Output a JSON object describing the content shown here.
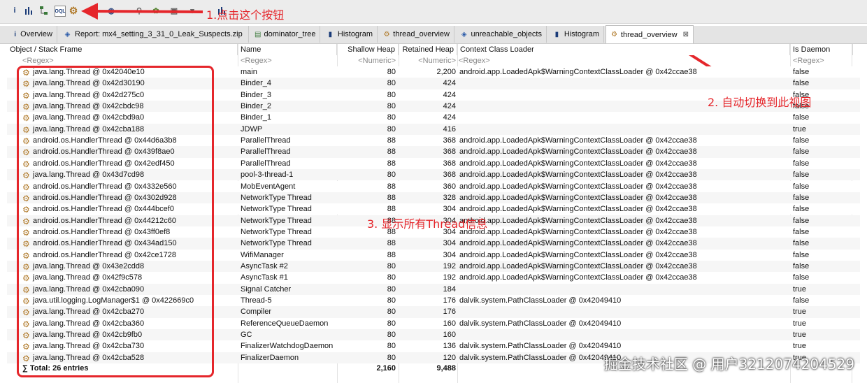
{
  "toolbar": {
    "icons": [
      "info-icon",
      "histogram-icon",
      "dominator-tree-icon",
      "oql-icon",
      "thread-overview-icon"
    ]
  },
  "annotations": {
    "step1": "1.点击这个按钮",
    "step2": "2. 自动切换到此视图",
    "step3": "3. 显示所有Thread信息"
  },
  "tabs": [
    {
      "label": "Overview",
      "icon": "info-icon"
    },
    {
      "label": "Report: mx4_setting_3_31_0_Leak_Suspects.zip",
      "icon": "report-icon"
    },
    {
      "label": "dominator_tree",
      "icon": "dominator-tree-icon"
    },
    {
      "label": "Histogram",
      "icon": "histogram-icon"
    },
    {
      "label": "thread_overview",
      "icon": "thread-icon"
    },
    {
      "label": "unreachable_objects",
      "icon": "unreachable-icon"
    },
    {
      "label": "Histogram",
      "icon": "histogram-icon"
    },
    {
      "label": "thread_overview",
      "icon": "thread-icon",
      "active": true
    }
  ],
  "columns": {
    "object": "Object / Stack Frame",
    "name": "Name",
    "shallow": "Shallow Heap",
    "retained": "Retained Heap",
    "loader": "Context Class Loader",
    "daemon": "Is Daemon"
  },
  "filter": {
    "regex": "<Regex>",
    "numeric": "<Numeric>"
  },
  "rows": [
    [
      "java.lang.Thread @ 0x42040e10",
      "main",
      "80",
      "2,200",
      "android.app.LoadedApk$WarningContextClassLoader @ 0x42ccae38",
      "false"
    ],
    [
      "java.lang.Thread @ 0x42d30190",
      "Binder_4",
      "80",
      "424",
      "",
      "false"
    ],
    [
      "java.lang.Thread @ 0x42d275c0",
      "Binder_3",
      "80",
      "424",
      "",
      "false"
    ],
    [
      "java.lang.Thread @ 0x42cbdc98",
      "Binder_2",
      "80",
      "424",
      "",
      "false"
    ],
    [
      "java.lang.Thread @ 0x42cbd9a0",
      "Binder_1",
      "80",
      "424",
      "",
      "false"
    ],
    [
      "java.lang.Thread @ 0x42cba188",
      "JDWP",
      "80",
      "416",
      "",
      "true"
    ],
    [
      "android.os.HandlerThread @ 0x44d6a3b8",
      "ParallelThread",
      "88",
      "368",
      "android.app.LoadedApk$WarningContextClassLoader @ 0x42ccae38",
      "false"
    ],
    [
      "android.os.HandlerThread @ 0x439f8ae0",
      "ParallelThread",
      "88",
      "368",
      "android.app.LoadedApk$WarningContextClassLoader @ 0x42ccae38",
      "false"
    ],
    [
      "android.os.HandlerThread @ 0x42edf450",
      "ParallelThread",
      "88",
      "368",
      "android.app.LoadedApk$WarningContextClassLoader @ 0x42ccae38",
      "false"
    ],
    [
      "java.lang.Thread @ 0x43d7cd98",
      "pool-3-thread-1",
      "80",
      "368",
      "android.app.LoadedApk$WarningContextClassLoader @ 0x42ccae38",
      "false"
    ],
    [
      "android.os.HandlerThread @ 0x4332e560",
      "MobEventAgent",
      "88",
      "360",
      "android.app.LoadedApk$WarningContextClassLoader @ 0x42ccae38",
      "false"
    ],
    [
      "android.os.HandlerThread @ 0x4302d928",
      "NetworkType Thread",
      "88",
      "328",
      "android.app.LoadedApk$WarningContextClassLoader @ 0x42ccae38",
      "false"
    ],
    [
      "android.os.HandlerThread @ 0x444bcef0",
      "NetworkType Thread",
      "88",
      "304",
      "android.app.LoadedApk$WarningContextClassLoader @ 0x42ccae38",
      "false"
    ],
    [
      "android.os.HandlerThread @ 0x44212c60",
      "NetworkType Thread",
      "88",
      "304",
      "android.app.LoadedApk$WarningContextClassLoader @ 0x42ccae38",
      "false"
    ],
    [
      "android.os.HandlerThread @ 0x43ff0ef8",
      "NetworkType Thread",
      "88",
      "304",
      "android.app.LoadedApk$WarningContextClassLoader @ 0x42ccae38",
      "false"
    ],
    [
      "android.os.HandlerThread @ 0x434ad150",
      "NetworkType Thread",
      "88",
      "304",
      "android.app.LoadedApk$WarningContextClassLoader @ 0x42ccae38",
      "false"
    ],
    [
      "android.os.HandlerThread @ 0x42ce1728",
      "WifiManager",
      "88",
      "304",
      "android.app.LoadedApk$WarningContextClassLoader @ 0x42ccae38",
      "false"
    ],
    [
      "java.lang.Thread @ 0x43e2cdd8",
      "AsyncTask #2",
      "80",
      "192",
      "android.app.LoadedApk$WarningContextClassLoader @ 0x42ccae38",
      "false"
    ],
    [
      "java.lang.Thread @ 0x42f9c578",
      "AsyncTask #1",
      "80",
      "192",
      "android.app.LoadedApk$WarningContextClassLoader @ 0x42ccae38",
      "false"
    ],
    [
      "java.lang.Thread @ 0x42cba090",
      "Signal Catcher",
      "80",
      "184",
      "",
      "true"
    ],
    [
      "java.util.logging.LogManager$1 @ 0x422669c0",
      "Thread-5",
      "80",
      "176",
      "dalvik.system.PathClassLoader @ 0x42049410",
      "false"
    ],
    [
      "java.lang.Thread @ 0x42cba270",
      "Compiler",
      "80",
      "176",
      "",
      "true"
    ],
    [
      "java.lang.Thread @ 0x42cba360",
      "ReferenceQueueDaemon",
      "80",
      "160",
      "dalvik.system.PathClassLoader @ 0x42049410",
      "true"
    ],
    [
      "java.lang.Thread @ 0x42cb9fb0",
      "GC",
      "80",
      "160",
      "",
      "true"
    ],
    [
      "java.lang.Thread @ 0x42cba730",
      "FinalizerWatchdogDaemon",
      "80",
      "136",
      "dalvik.system.PathClassLoader @ 0x42049410",
      "true"
    ],
    [
      "java.lang.Thread @ 0x42cba528",
      "FinalizerDaemon",
      "80",
      "120",
      "dalvik.system.PathClassLoader @ 0x42049410",
      "true"
    ]
  ],
  "total": {
    "label": "Total: 26 entries",
    "shallow": "2,160",
    "retained": "9,488"
  },
  "watermark": "掘金技术社区 @ 用户3212074204529",
  "colors": {
    "annotation": "#e5262b",
    "gear": "#b07a2a"
  }
}
